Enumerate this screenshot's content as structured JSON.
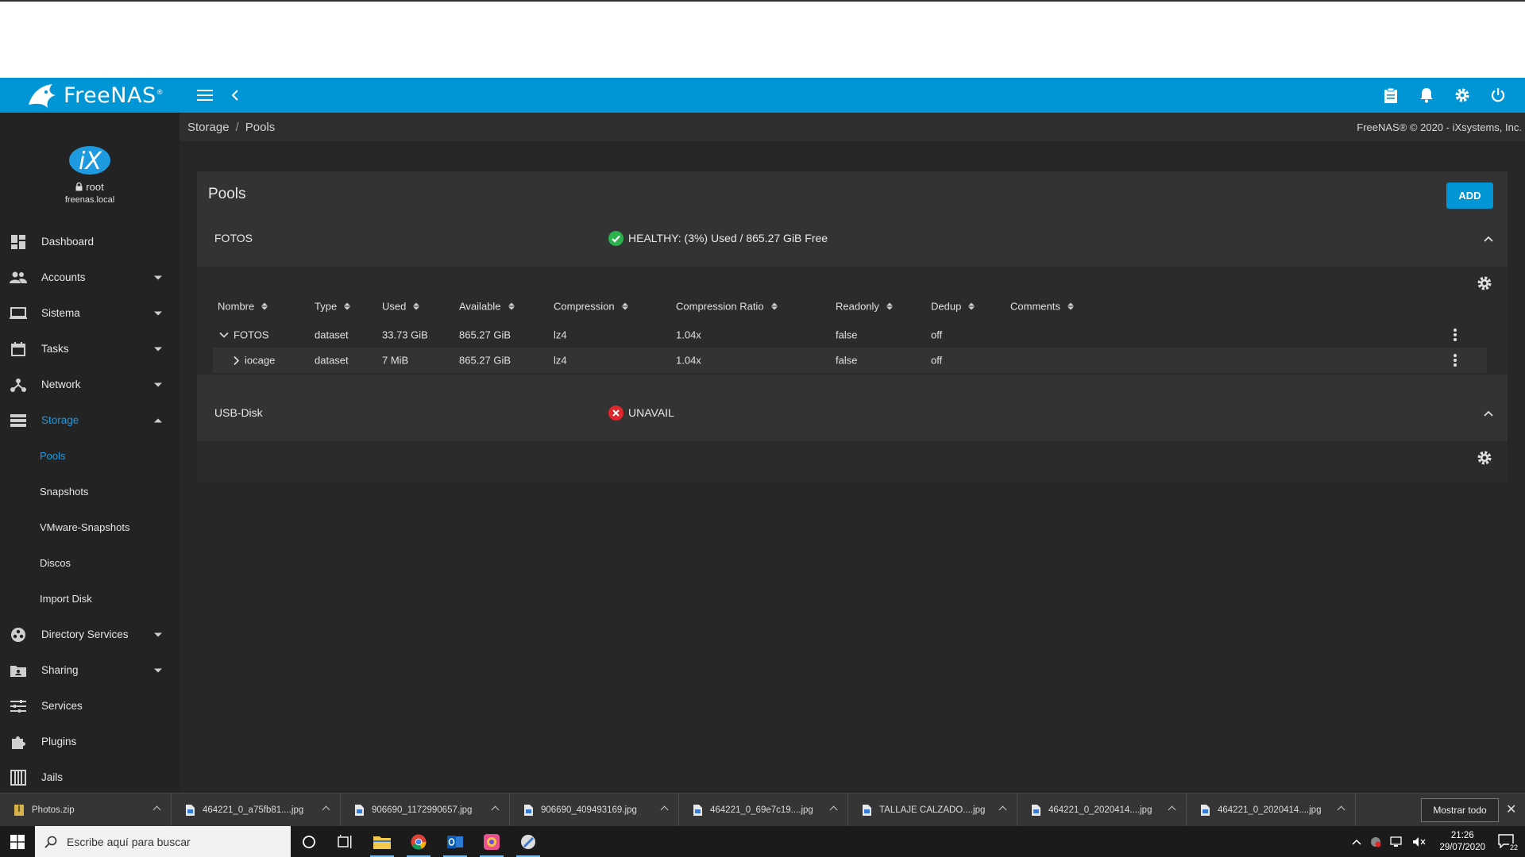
{
  "app": {
    "brand": "FreeNAS",
    "brand_tm": "®",
    "copyright": "FreeNAS® © 2020 - iXsystems, Inc.",
    "accent_color": "#0095d5"
  },
  "user": {
    "name": "root",
    "host": "freenas.local"
  },
  "breadcrumb": [
    "Storage",
    "Pools"
  ],
  "sidebar": {
    "items": [
      {
        "label": "Dashboard",
        "icon": "dashboard-icon",
        "has_caret": false
      },
      {
        "label": "Accounts",
        "icon": "accounts-icon",
        "has_caret": true
      },
      {
        "label": "Sistema",
        "icon": "laptop-icon",
        "has_caret": true
      },
      {
        "label": "Tasks",
        "icon": "calendar-icon",
        "has_caret": true
      },
      {
        "label": "Network",
        "icon": "network-icon",
        "has_caret": true
      },
      {
        "label": "Storage",
        "icon": "storage-icon",
        "has_caret": true,
        "expanded": true,
        "active": true
      },
      {
        "label": "Directory Services",
        "icon": "directory-services-icon",
        "has_caret": true
      },
      {
        "label": "Sharing",
        "icon": "sharing-icon",
        "has_caret": true
      },
      {
        "label": "Services",
        "icon": "services-icon",
        "has_caret": false
      },
      {
        "label": "Plugins",
        "icon": "plugins-icon",
        "has_caret": false
      },
      {
        "label": "Jails",
        "icon": "jails-icon",
        "has_caret": false
      }
    ],
    "storage_sub": [
      "Pools",
      "Snapshots",
      "VMware-Snapshots",
      "Discos",
      "Import Disk"
    ]
  },
  "pools": {
    "title": "Pools",
    "add_label": "ADD",
    "columns": [
      "Nombre",
      "Type",
      "Used",
      "Available",
      "Compression",
      "Compression Ratio",
      "Readonly",
      "Dedup",
      "Comments"
    ],
    "list": [
      {
        "name": "FOTOS",
        "status": "HEALTHY: (3%) Used / 865.27 GiB Free",
        "status_color": "#2bb24c",
        "rows": [
          {
            "name": "FOTOS",
            "type": "dataset",
            "used": "33.73 GiB",
            "available": "865.27 GiB",
            "compression": "lz4",
            "ratio": "1.04x",
            "readonly": "false",
            "dedup": "off",
            "comments": ""
          },
          {
            "name": "iocage",
            "type": "dataset",
            "used": "7 MiB",
            "available": "865.27 GiB",
            "compression": "lz4",
            "ratio": "1.04x",
            "readonly": "false",
            "dedup": "off",
            "comments": ""
          }
        ]
      },
      {
        "name": "USB-Disk",
        "status": "UNAVAIL",
        "status_color": "#e0262b",
        "rows": []
      }
    ]
  },
  "downloads": {
    "items": [
      "Photos.zip",
      "464221_0_a75fb81....jpg",
      "906690_1172990657.jpg",
      "906690_409493169.jpg",
      "464221_0_69e7c19....jpg",
      "TALLAJE CALZADO....jpg",
      "464221_0_2020414....jpg",
      "464221_0_2020414....jpg"
    ],
    "show_all": "Mostrar todo"
  },
  "taskbar": {
    "search_placeholder": "Escribe aquí para buscar",
    "time": "21:26",
    "date": "29/07/2020",
    "notifications": "22"
  }
}
